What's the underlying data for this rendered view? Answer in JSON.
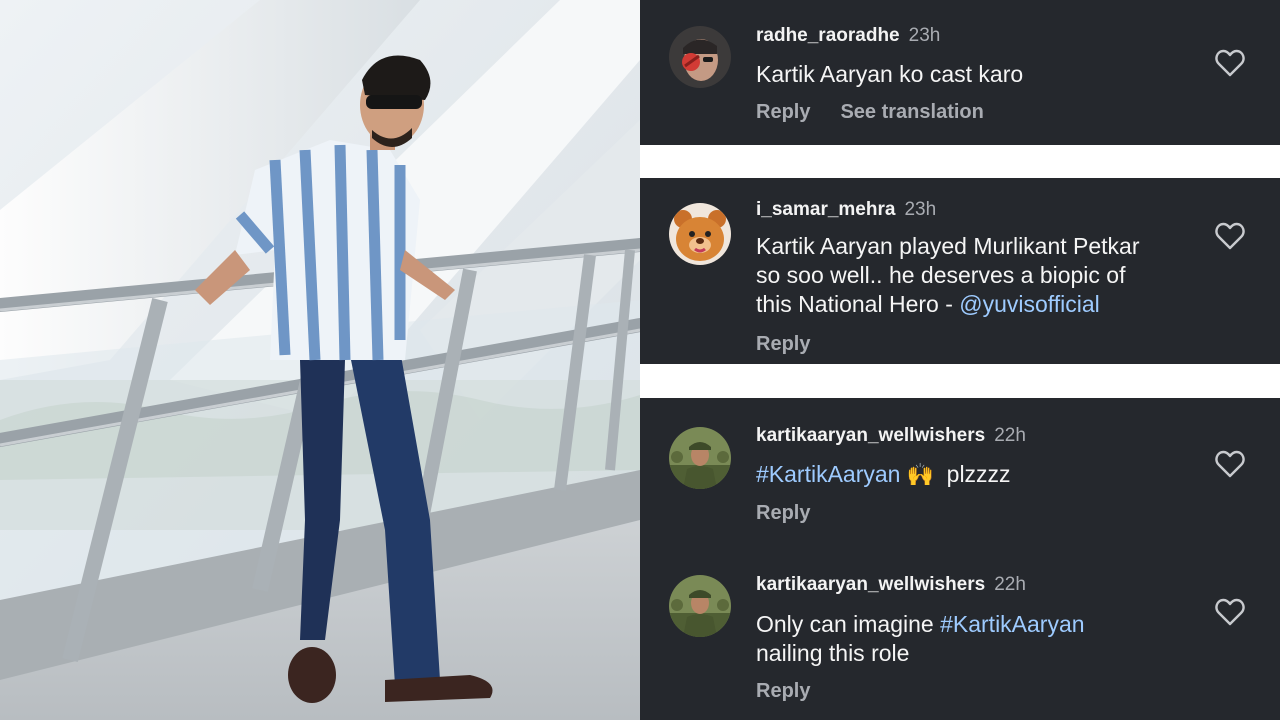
{
  "comments": [
    {
      "username": "radhe_raoradhe",
      "time": "23h",
      "text": "Kartik Aaryan ko cast karo",
      "reply_label": "Reply",
      "translate_label": "See translation"
    },
    {
      "username": "i_samar_mehra",
      "time": "23h",
      "text_line1": "Kartik Aaryan played Murlikant Petkar",
      "text_line2": "so soo well.. he deserves a biopic of",
      "text_line3": "this National Hero - ",
      "mention": "@yuvisofficial",
      "reply_label": "Reply"
    },
    {
      "username": "kartikaaryan_wellwishers",
      "time": "22h",
      "hashtag": "#KartikAaryan",
      "emoji": "🙌",
      "text_after": "plzzzz",
      "reply_label": "Reply"
    },
    {
      "username": "kartikaaryan_wellwishers",
      "time": "22h",
      "text_before": "Only can imagine ",
      "hashtag": "#KartikAaryan",
      "text_line2": "nailing this role",
      "reply_label": "Reply"
    }
  ],
  "icons": {
    "like": "heart-outline-icon"
  },
  "colors": {
    "panel_bg": "#25282d",
    "text": "#f5f5f5",
    "muted": "#a9acb2",
    "link": "#9ecbff"
  }
}
